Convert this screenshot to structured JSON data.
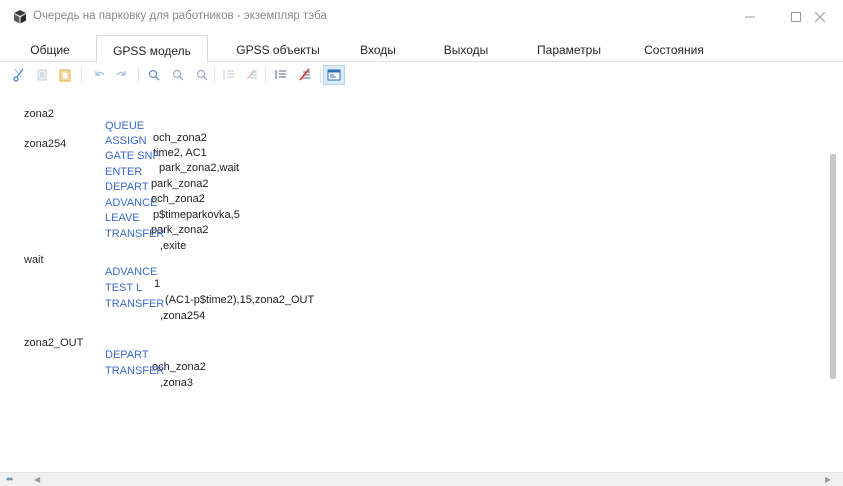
{
  "window": {
    "title": "Очередь на парковку для работников - экземпляр тэба",
    "app_icon": "gpss-app-icon",
    "controls": [
      "minimize-icon",
      "maximize-icon",
      "close-icon"
    ]
  },
  "tabs": [
    {
      "label": "Общие",
      "active": false
    },
    {
      "label": "GPSS модель",
      "active": true
    },
    {
      "label": "GPSS объекты",
      "active": false
    },
    {
      "label": "Входы",
      "active": false
    },
    {
      "label": "Выходы",
      "active": false
    },
    {
      "label": "Параметры",
      "active": false
    },
    {
      "label": "Состояния",
      "active": false
    }
  ],
  "toolbar": {
    "buttons": [
      "cut-icon",
      "copy-icon",
      "paste-icon",
      "undo-icon",
      "redo-icon",
      "zoom-in-icon",
      "zoom-out-icon",
      "zoom-reset-icon",
      "indent-icon",
      "comment-icon",
      "list-icon",
      "uncomment-icon",
      "model-view-icon"
    ],
    "pressed": "model-view-icon"
  },
  "colors": {
    "keyword": "#3a6bc8",
    "text": "#1f1f1f",
    "title": "#8a8a8a",
    "pressed_bg": "#dcebfa"
  },
  "code": [
    {
      "label": "zona2",
      "op": "QUEUE",
      "arg": "och_zona2"
    },
    {
      "label": "",
      "op": "ASSIGN",
      "arg": "time2, AC1"
    },
    {
      "label": "zona254",
      "op": "GATE SNF",
      "arg": "park_zona2,wait"
    },
    {
      "label": "",
      "op": "ENTER",
      "arg": "park_zona2"
    },
    {
      "label": "",
      "op": "DEPART",
      "arg": "och_zona2"
    },
    {
      "label": "",
      "op": "ADVANCE",
      "arg": "p$timeparkovka,5"
    },
    {
      "label": "",
      "op": "LEAVE",
      "arg": "park_zona2"
    },
    {
      "label": "",
      "op": "TRANSFER",
      "arg": ",exite"
    },
    {
      "label": "",
      "op": "",
      "arg": ""
    },
    {
      "label": "wait",
      "op": "ADVANCE",
      "arg": "1"
    },
    {
      "label": "",
      "op": "TEST L",
      "arg": "(AC1-p$time2),15,zona2_OUT"
    },
    {
      "label": "",
      "op": "TRANSFER",
      "arg": ",zona254"
    },
    {
      "label": "",
      "op": "",
      "arg": ""
    },
    {
      "label": "",
      "op": "",
      "arg": ""
    },
    {
      "label": "",
      "op": "",
      "arg": ""
    },
    {
      "label": "zona2_OUT",
      "op": "DEPART",
      "arg": "och_zona2"
    },
    {
      "label": "",
      "op": "TRANSFER",
      "arg": ",zona3"
    }
  ],
  "statusbar": {
    "split_icon": "split-view-icon",
    "left_arrow": "scroll-left-icon",
    "right_arrow": "scroll-right-icon"
  }
}
